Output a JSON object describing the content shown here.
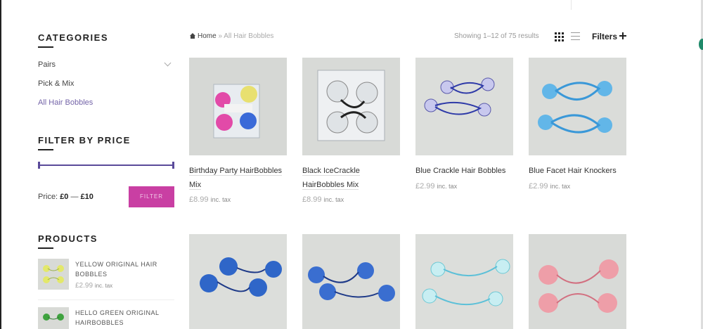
{
  "sidebar": {
    "categories_title": "CATEGORIES",
    "categories": [
      {
        "label": "Pairs",
        "expandable": true,
        "active": false
      },
      {
        "label": "Pick & Mix",
        "expandable": false,
        "active": false
      },
      {
        "label": "All Hair Bobbles",
        "expandable": false,
        "active": true
      }
    ],
    "filter_title": "FILTER BY PRICE",
    "price_label": "Price:",
    "price_min": "£0",
    "price_sep": "—",
    "price_max": "£10",
    "filter_button": "FILTER",
    "products_title": "PRODUCTS",
    "products": [
      {
        "name": "YELLOW ORIGINAL HAIR BOBBLES",
        "price": "£2.99",
        "tax": "inc. tax"
      },
      {
        "name": "HELLO GREEN ORIGINAL HAIRBOBBLES",
        "price": "",
        "tax": ""
      }
    ]
  },
  "toolbar": {
    "breadcrumb_home": "Home",
    "breadcrumb_sep": "»",
    "breadcrumb_current": "All Hair Bobbles",
    "result_count": "Showing 1–12 of 75 results",
    "filters_label": "Filters"
  },
  "products": [
    {
      "name": "Birthday Party HairBobbles Mix",
      "price": "£8.99",
      "tax": "inc. tax"
    },
    {
      "name": "Black IceCrackle HairBobbles Mix",
      "price": "£8.99",
      "tax": "inc. tax"
    },
    {
      "name": "Blue Crackle Hair Bobbles",
      "price": "£2.99",
      "tax": "inc. tax"
    },
    {
      "name": "Blue Facet Hair Knockers",
      "price": "£2.99",
      "tax": "inc. tax"
    },
    {
      "name": "",
      "price": "",
      "tax": ""
    },
    {
      "name": "",
      "price": "",
      "tax": ""
    },
    {
      "name": "",
      "price": "",
      "tax": ""
    },
    {
      "name": "",
      "price": "",
      "tax": ""
    }
  ],
  "colors": {
    "accent_purple": "#7464a8",
    "filter_pink": "#c93fa3",
    "slider": "#5a4a9a"
  }
}
